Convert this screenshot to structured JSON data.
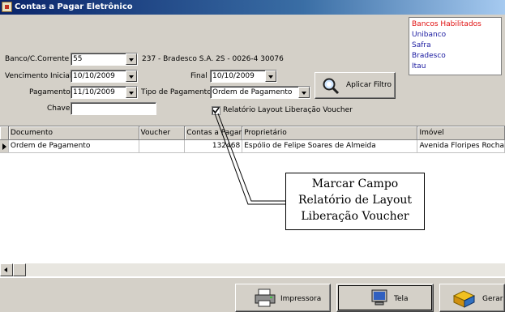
{
  "window": {
    "title": "Contas a Pagar Eletrônico"
  },
  "filters": {
    "banco_label": "Banco/C.Corrente",
    "banco_value": "55",
    "banco_desc": "237 - Bradesco S.A.  2S - 0026-4  30076",
    "venc_inicial_label": "Vencimento Inicial",
    "venc_inicial_value": "10/10/2009",
    "final_label": "Final",
    "final_value": "10/10/2009",
    "pagamento_label": "Pagamento",
    "pagamento_value": "11/10/2009",
    "tipo_pagamento_label": "Tipo de Pagamento",
    "tipo_pagamento_value": "Ordem de Pagamento",
    "chave_label": "Chave",
    "chave_value": "",
    "aplicar_filtro_label": "Aplicar Filtro",
    "relatorio_checkbox_label": "Relatório Layout Liberação Voucher",
    "relatorio_checked": true
  },
  "banks": {
    "header": "Bancos Habilitados",
    "items": [
      "Unibanco",
      "Safra",
      "Bradesco",
      "Itau"
    ]
  },
  "grid": {
    "columns": [
      "Documento",
      "Voucher",
      "Contas a Pagar",
      "Proprietário",
      "Imóvel"
    ],
    "rows": [
      [
        "Ordem de Pagamento",
        "",
        "132468",
        "Espólio de Felipe Soares de Almeida",
        "Avenida Floripes Rocha"
      ]
    ]
  },
  "callout": {
    "lines": [
      "Marcar Campo",
      "Relatório de Layout",
      "Liberação Voucher"
    ]
  },
  "bottom_buttons": {
    "impressora": "Impressora",
    "tela": "Tela",
    "gerar": "Gerar"
  }
}
